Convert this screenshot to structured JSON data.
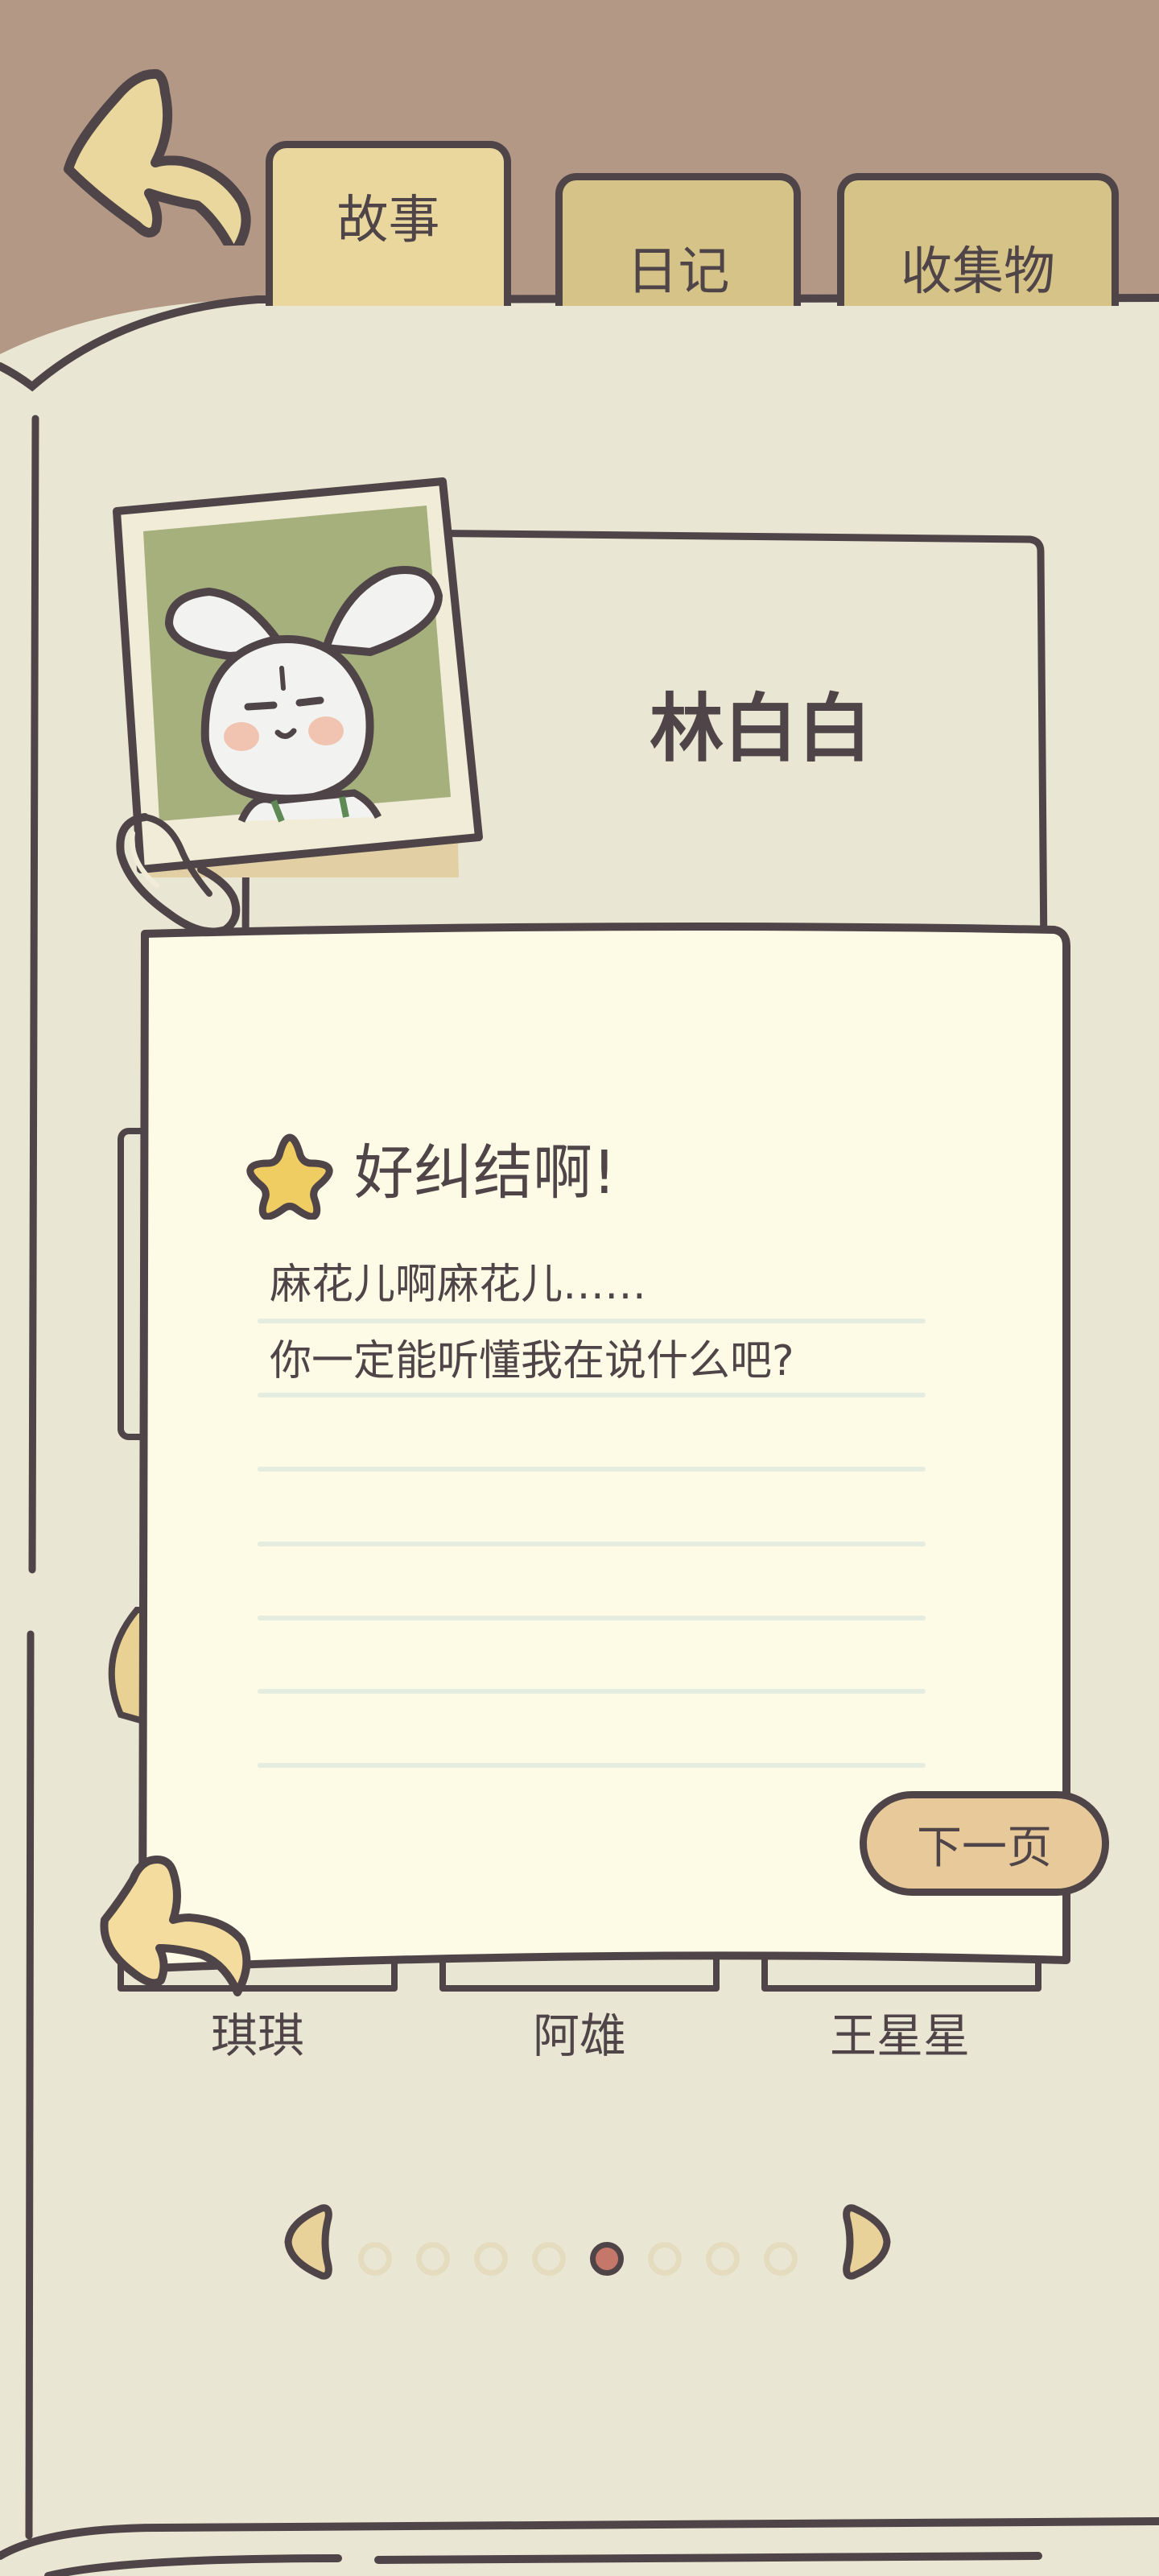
{
  "tabs": [
    {
      "label": "故事",
      "active": true
    },
    {
      "label": "日记",
      "active": false
    },
    {
      "label": "收集物",
      "active": false
    }
  ],
  "character": {
    "name": "林白白",
    "icon": "bunny-portrait"
  },
  "note": {
    "title": "好纠结啊!",
    "title_icon": "star-icon",
    "lines": [
      "麻花儿啊麻花儿……",
      "你一定能听懂我在说什么吧?"
    ],
    "next_label": "下一页"
  },
  "characters": [
    "琪琪",
    "阿雄",
    "王星星"
  ],
  "pagination": {
    "total": 8,
    "current": 5
  },
  "colors": {
    "outline": "#4f4548",
    "page": "#e9e7d3",
    "note_paper": "#fdfbe6",
    "tab_active": "#e9d79d",
    "tab_inactive": "#d6c387",
    "header_bg": "#b39886",
    "active_dot": "#c57769",
    "button": "#e7c99a"
  }
}
